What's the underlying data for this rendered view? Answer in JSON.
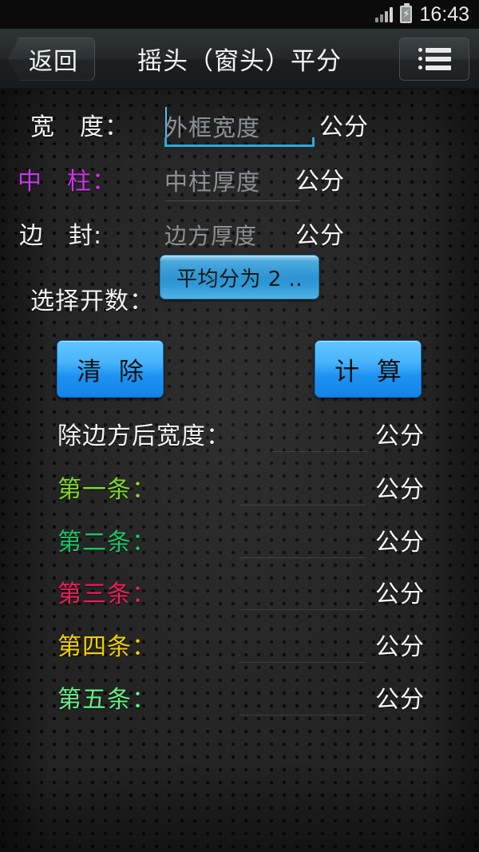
{
  "status_bar": {
    "time": "16:43",
    "signal_icon": "signal-bars-icon",
    "battery_icon": "battery-charging-icon"
  },
  "action_bar": {
    "back_label": "返回",
    "title": "摇头（窗头）平分",
    "menu_icon": "list-menu-icon"
  },
  "form": {
    "fields": [
      {
        "label": "宽　度：",
        "placeholder": "外框宽度",
        "value": "",
        "unit": "公分",
        "focused": true
      },
      {
        "label": "中　柱：",
        "placeholder": "中柱厚度",
        "value": "",
        "unit": "公分",
        "focused": false
      },
      {
        "label": "边　封:",
        "placeholder": "边方厚度",
        "value": "",
        "unit": "公分",
        "focused": false
      }
    ],
    "spinner": {
      "label": "选择开数：",
      "selected": "平均分为 2 .."
    },
    "buttons": {
      "clear": "清 除",
      "calculate": "计 算"
    }
  },
  "results": {
    "header": {
      "label": "除边方后宽度：",
      "value": "",
      "unit": "公分"
    },
    "rows": [
      {
        "label": "第一条：",
        "value": "",
        "unit": "公分"
      },
      {
        "label": "第二条：",
        "value": "",
        "unit": "公分"
      },
      {
        "label": "第三条：",
        "value": "",
        "unit": "公分"
      },
      {
        "label": "第四条：",
        "value": "",
        "unit": "公分"
      },
      {
        "label": "第五条：",
        "value": "",
        "unit": "公分"
      }
    ]
  },
  "colors": {
    "accent_blue": "#2fa8d8",
    "button_blue": "#1e93f2",
    "label_white": "#f2f4f5",
    "center_post_magenta": "#cc33ee",
    "row1_green": "#7fd82a",
    "row2_green": "#1ec267",
    "row3_pink": "#e8205c",
    "row4_gold": "#f0d000",
    "row5_green": "#66ee88",
    "background": "#232323",
    "actionbar": "#24282a"
  }
}
